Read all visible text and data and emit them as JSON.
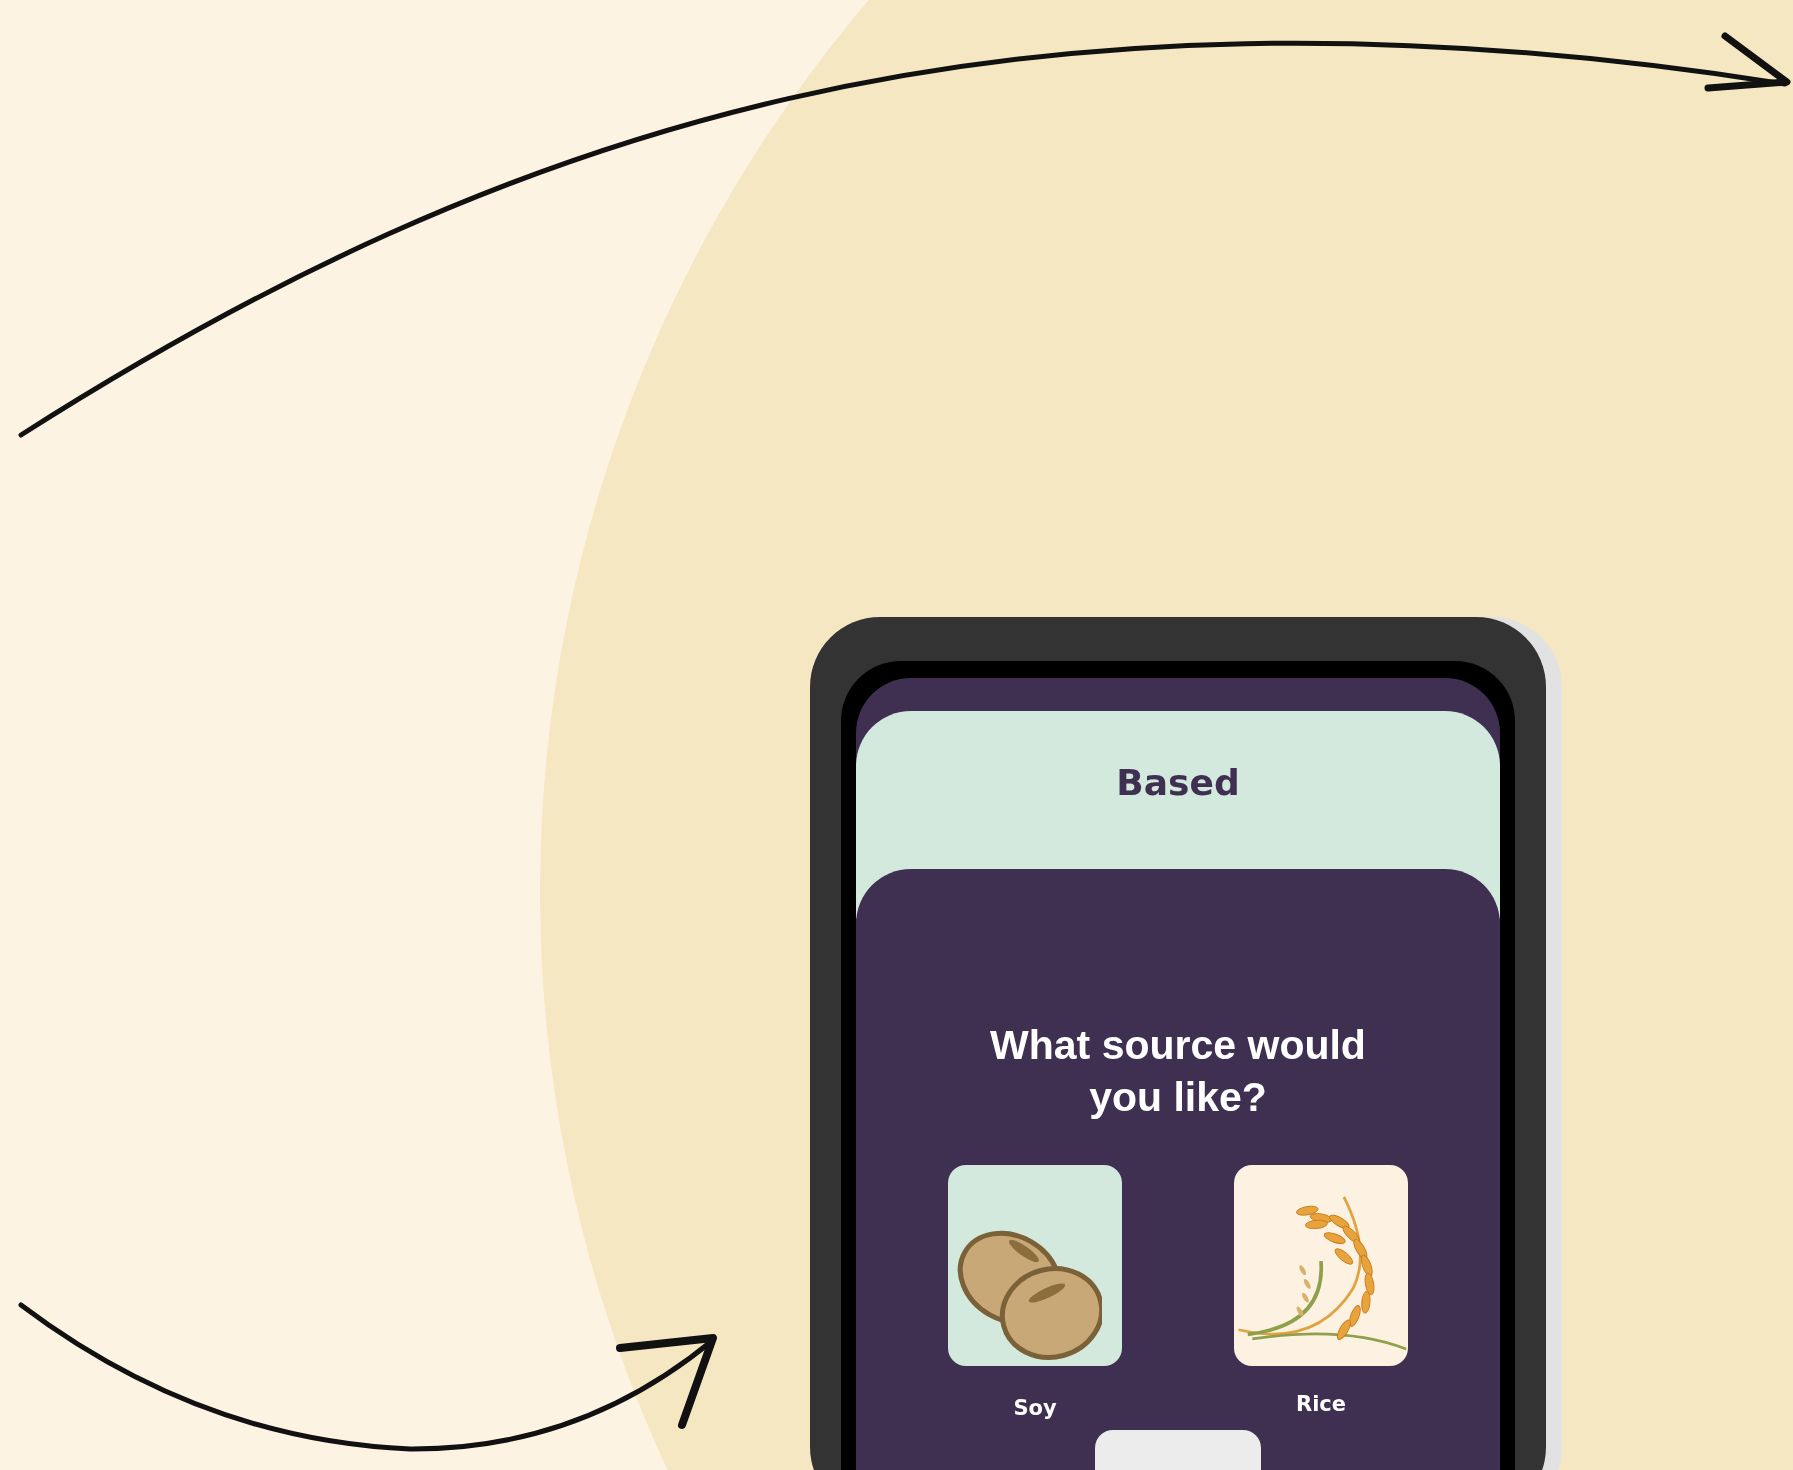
{
  "app": {
    "title": "Based"
  },
  "question": "What source would you like?",
  "options": [
    {
      "label": "Soy",
      "kind": "soy"
    },
    {
      "label": "Rice",
      "kind": "rice"
    }
  ]
}
